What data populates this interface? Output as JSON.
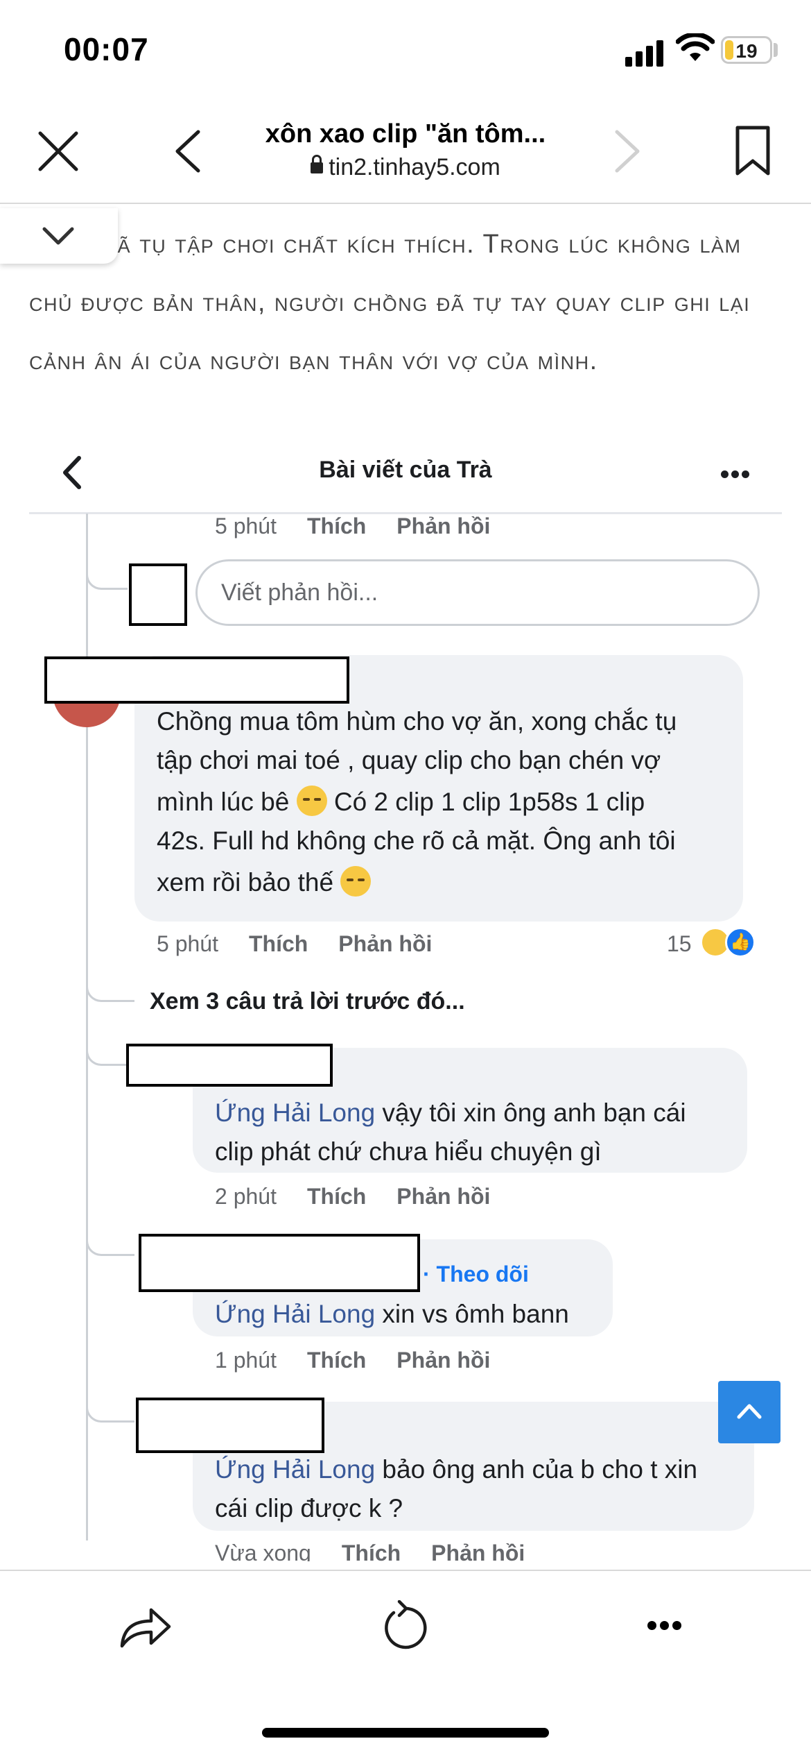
{
  "status_bar": {
    "time": "00:07",
    "battery": "19"
  },
  "browser": {
    "title": "xôn xao clip \"ăn tôm...",
    "url": "tin2.tinhay5.com"
  },
  "article": {
    "text": "g này đã tụ tập chơi chất kích thích. Trong lúc không làm chủ được bản thân, người chồng đã tự tay quay clip ghi lại cảnh ân ái của người bạn thân với vợ của mình."
  },
  "fb": {
    "header_title": "Bài viết của Trà",
    "actions": {
      "like": "Thích",
      "reply": "Phản hồi"
    },
    "top_meta_time": "5 phút",
    "reply_placeholder": "Viết phản hồi...",
    "main_comment": {
      "line1": "Chồng mua tôm hùm cho vợ ăn, xong chắc tụ",
      "line2": "tập chơi mai toé , quay clip cho bạn chén vợ",
      "line3": "mình lúc bê",
      "line3b": "Có 2 clip 1 clip 1p58s 1 clip",
      "line4": "42s. Full hd không che rõ cả mặt. Ông anh tôi",
      "line5": "xem rồi bảo thế",
      "time": "5 phút",
      "reaction_count": "15"
    },
    "see_more": "Xem 3 câu trả lời trước đó...",
    "replies": [
      {
        "mention": "Ứng Hải Long",
        "text_line1": " vậy tôi xin ông anh bạn cái",
        "text_line2": "clip phát chứ chưa hiểu chuyện gì",
        "time": "2 phút"
      },
      {
        "follow": "· Theo dõi",
        "mention": "Ứng Hải Long",
        "text_line1": " xin vs ômh bann",
        "time": "1 phút"
      },
      {
        "mention": "Ứng Hải Long",
        "text_line1": " bảo ông anh của b cho t xin",
        "text_line2": "cái clip được k ?",
        "time": "Vừa xong"
      }
    ]
  },
  "colors": {
    "link": "#385898",
    "follow": "#1877f2",
    "bubble": "#f0f2f5",
    "scroll_top": "#2b87e3"
  },
  "icons": [
    "close-icon",
    "back-icon",
    "forward-icon",
    "bookmark-icon",
    "lock-icon",
    "chevron-down-icon",
    "more-icon",
    "share-icon",
    "reload-icon",
    "chevron-up-icon"
  ]
}
